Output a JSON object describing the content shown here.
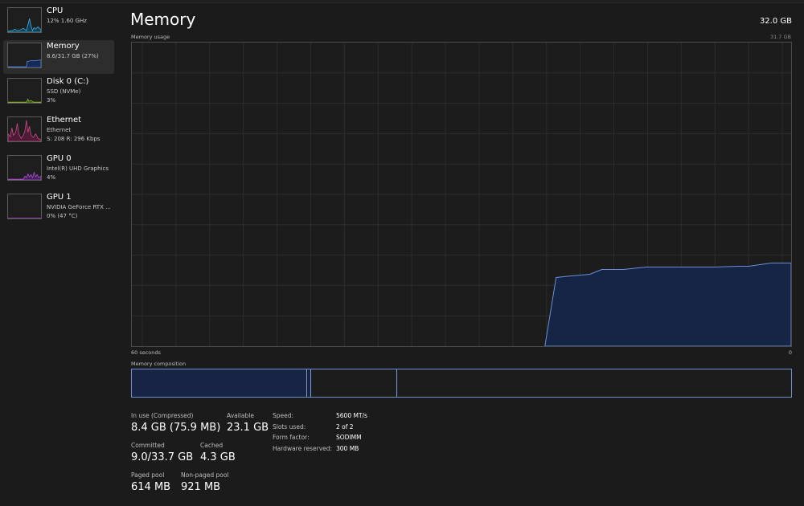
{
  "sidebar": {
    "items": [
      {
        "title": "CPU",
        "line1": "12%  1.60 GHz",
        "line2": "",
        "icon": "cpu-graph-icon",
        "color": "#3fb7e6"
      },
      {
        "title": "Memory",
        "line1": "8.6/31.7 GB (27%)",
        "line2": "",
        "icon": "memory-graph-icon",
        "color": "#5b8de0",
        "selected": true
      },
      {
        "title": "Disk 0 (C:)",
        "line1": "SSD (NVMe)",
        "line2": "3%",
        "icon": "disk-graph-icon",
        "color": "#8fb832"
      },
      {
        "title": "Ethernet",
        "line1": "Ethernet",
        "line2": "S: 208  R: 296 Kbps",
        "icon": "ethernet-graph-icon",
        "color": "#d04c8c"
      },
      {
        "title": "GPU 0",
        "line1": "Intel(R) UHD Graphics",
        "line2": "4%",
        "icon": "gpu-graph-icon",
        "color": "#b44fd8"
      },
      {
        "title": "GPU 1",
        "line1": "NVIDIA GeForce RTX ...",
        "line2": "0%  (47 °C)",
        "icon": "gpu-graph-icon",
        "color": "#b44fd8"
      }
    ]
  },
  "main": {
    "title": "Memory",
    "total": "32.0 GB",
    "graph_label": "Memory usage",
    "graph_max": "31.7 GB",
    "axis_left": "60 seconds",
    "axis_right": "0",
    "composition_label": "Memory composition",
    "fill_color": "#162446",
    "line_color": "#6b8fd6"
  },
  "stats": {
    "in_use_label": "In use (Compressed)",
    "in_use_value": "8.4 GB (75.9 MB)",
    "available_label": "Available",
    "available_value": "23.1 GB",
    "committed_label": "Committed",
    "committed_value": "9.0/33.7 GB",
    "cached_label": "Cached",
    "cached_value": "4.3 GB",
    "paged_label": "Paged pool",
    "paged_value": "614 MB",
    "nonpaged_label": "Non-paged pool",
    "nonpaged_value": "921 MB"
  },
  "details": {
    "speed_label": "Speed:",
    "speed_value": "5600 MT/s",
    "slots_label": "Slots used:",
    "slots_value": "2 of 2",
    "form_label": "Form factor:",
    "form_value": "SODIMM",
    "hw_label": "Hardware reserved:",
    "hw_value": "300 MB"
  }
}
